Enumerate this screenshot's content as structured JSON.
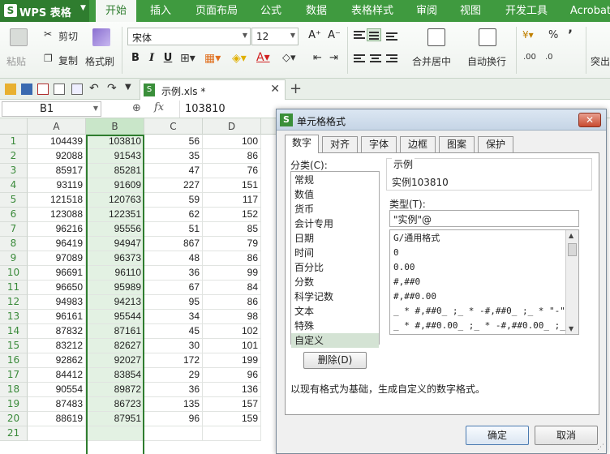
{
  "app": {
    "name": "WPS 表格",
    "logo": "S",
    "menu_tabs": [
      "开始",
      "插入",
      "页面布局",
      "公式",
      "数据",
      "表格样式",
      "审阅",
      "视图",
      "开发工具",
      "Acrobat"
    ],
    "active_tab": "开始"
  },
  "ribbon": {
    "paste": "粘贴",
    "cut": "剪切",
    "copy": "复制",
    "format_painter": "格式刷",
    "font_name": "宋体",
    "font_size": "12",
    "grow_font": "A⁺",
    "shrink_font": "A⁻",
    "bold": "B",
    "italic": "I",
    "underline": "U",
    "merge_center": "合并居中",
    "wrap_text": "自动换行",
    "percent": "%",
    "comma": "’",
    "more": "突出"
  },
  "document": {
    "tab_name": "示例.xls *"
  },
  "formula_bar": {
    "name_box": "B1",
    "fx": "fx",
    "value": "103810"
  },
  "sheet": {
    "columns": [
      "A",
      "B",
      "C",
      "D"
    ],
    "selected_column": "B",
    "rows": [
      {
        "n": "1",
        "a": "104439",
        "b": "103810",
        "c": "56",
        "d": "100"
      },
      {
        "n": "2",
        "a": "92088",
        "b": "91543",
        "c": "35",
        "d": "86"
      },
      {
        "n": "3",
        "a": "85917",
        "b": "85281",
        "c": "47",
        "d": "76"
      },
      {
        "n": "4",
        "a": "93119",
        "b": "91609",
        "c": "227",
        "d": "151"
      },
      {
        "n": "5",
        "a": "121518",
        "b": "120763",
        "c": "59",
        "d": "117"
      },
      {
        "n": "6",
        "a": "123088",
        "b": "122351",
        "c": "62",
        "d": "152"
      },
      {
        "n": "7",
        "a": "96216",
        "b": "95556",
        "c": "51",
        "d": "85"
      },
      {
        "n": "8",
        "a": "96419",
        "b": "94947",
        "c": "867",
        "d": "79"
      },
      {
        "n": "9",
        "a": "97089",
        "b": "96373",
        "c": "48",
        "d": "86"
      },
      {
        "n": "10",
        "a": "96691",
        "b": "96110",
        "c": "36",
        "d": "99"
      },
      {
        "n": "11",
        "a": "96650",
        "b": "95989",
        "c": "67",
        "d": "84"
      },
      {
        "n": "12",
        "a": "94983",
        "b": "94213",
        "c": "95",
        "d": "86"
      },
      {
        "n": "13",
        "a": "96161",
        "b": "95544",
        "c": "34",
        "d": "98"
      },
      {
        "n": "14",
        "a": "87832",
        "b": "87161",
        "c": "45",
        "d": "102"
      },
      {
        "n": "15",
        "a": "83212",
        "b": "82627",
        "c": "30",
        "d": "101"
      },
      {
        "n": "16",
        "a": "92862",
        "b": "92027",
        "c": "172",
        "d": "199"
      },
      {
        "n": "17",
        "a": "84412",
        "b": "83854",
        "c": "29",
        "d": "96"
      },
      {
        "n": "18",
        "a": "90554",
        "b": "89872",
        "c": "36",
        "d": "136"
      },
      {
        "n": "19",
        "a": "87483",
        "b": "86723",
        "c": "135",
        "d": "157"
      },
      {
        "n": "20",
        "a": "88619",
        "b": "87951",
        "c": "96",
        "d": "159"
      },
      {
        "n": "21",
        "a": "",
        "b": "",
        "c": "",
        "d": ""
      }
    ]
  },
  "dialog": {
    "title": "单元格格式",
    "tabs": [
      "数字",
      "对齐",
      "字体",
      "边框",
      "图案",
      "保护"
    ],
    "active_tab": "数字",
    "category_label": "分类(C):",
    "categories": [
      "常规",
      "数值",
      "货币",
      "会计专用",
      "日期",
      "时间",
      "百分比",
      "分数",
      "科学记数",
      "文本",
      "特殊",
      "自定义"
    ],
    "selected_category": "自定义",
    "example_label": "示例",
    "example_value": "实例103810",
    "type_label": "类型(T):",
    "type_value": "\"实例\"@",
    "type_list": [
      "G/通用格式",
      "0",
      "0.00",
      "#,##0",
      "#,##0.00",
      "_ * #,##0_ ;_ * -#,##0_ ;_ * \"-\"…",
      "_ * #,##0.00_ ;_ * -#,##0.00_ ;_…"
    ],
    "delete_button": "删除(D)",
    "hint": "以现有格式为基础，生成自定义的数字格式。",
    "ok_button": "确定",
    "cancel_button": "取消"
  },
  "colors": {
    "brand_green": "#3f9a3f",
    "selection_green": "#2f7d2f"
  }
}
